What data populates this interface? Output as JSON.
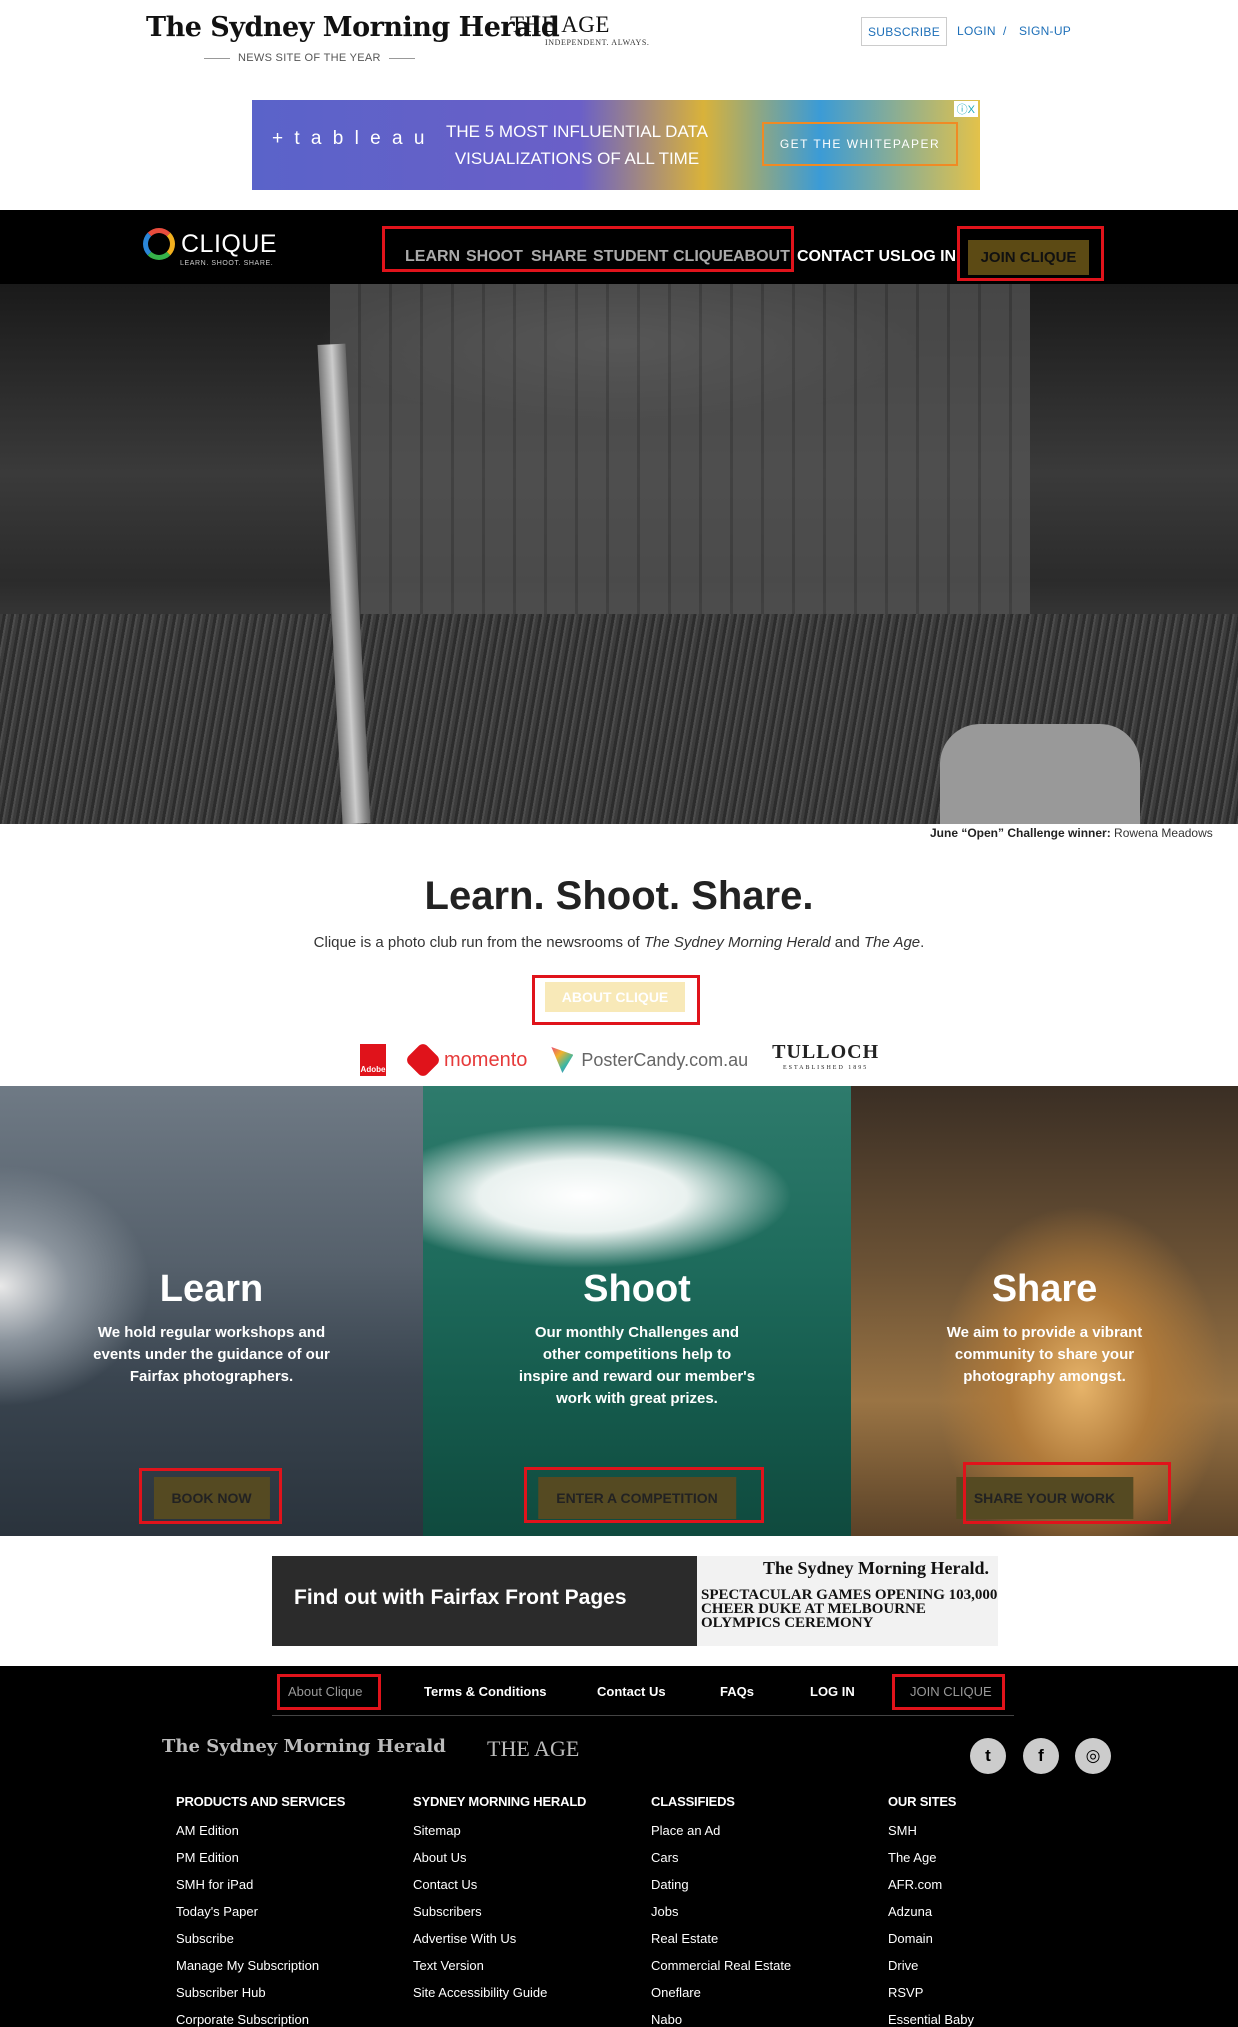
{
  "header": {
    "smh_logo": "The Sydney Morning Herald",
    "smh_tagline": "NEWS SITE OF THE YEAR",
    "age_logo": "THE AGE",
    "age_tagline": "INDEPENDENT. ALWAYS.",
    "subscribe": "SUBSCRIBE",
    "login": "LOGIN",
    "separator": "/",
    "signup": "SIGN-UP"
  },
  "top_ad": {
    "brand": "+ t a b l e a u",
    "headline": "THE 5 MOST INFLUENTIAL DATA VISUALIZATIONS OF ALL TIME",
    "cta": "GET THE WHITEPAPER",
    "ad_choice": "ⓘX"
  },
  "nav": {
    "logo": "CLIQUE",
    "logo_tagline": "LEARN. SHOOT. SHARE.",
    "items": [
      "LEARN",
      "SHOOT",
      "SHARE",
      "STUDENT CLIQUE",
      "ABOUT"
    ],
    "contact": "CONTACT US",
    "login": "LOG IN",
    "join": "JOIN CLIQUE"
  },
  "hero": {
    "caption_label": "June “Open” Challenge winner:",
    "caption_name": "Rowena Meadows"
  },
  "intro": {
    "title": "Learn. Shoot. Share.",
    "text_before": "Clique is a photo club run from the newsrooms of ",
    "paper1": "The Sydney Morning Herald",
    "text_and": " and ",
    "paper2": "The Age",
    "text_after": ".",
    "button": "ABOUT CLIQUE"
  },
  "sponsors": {
    "adobe": "Adobe",
    "momento": "momento",
    "postercandy": "PosterCandy.com.au",
    "tulloch": "TULLOCH",
    "tulloch_sub": "ESTABLISHED 1895"
  },
  "panels": [
    {
      "title": "Learn",
      "text": "We hold regular workshops and events under the guidance of our Fairfax photographers.",
      "button": "BOOK NOW"
    },
    {
      "title": "Shoot",
      "text": "Our monthly Challenges and other competitions help to inspire and reward our member's work with great prizes.",
      "button": "ENTER A COMPETITION"
    },
    {
      "title": "Share",
      "text": "We aim to provide a vibrant community to share your photography amongst.",
      "button": "SHARE YOUR WORK"
    }
  ],
  "fairfax_ad": {
    "text": "Find out with Fairfax Front Pages",
    "paper_title": "The Sydney Morning Herald.",
    "paper_headline": "SPECTACULAR GAMES OPENING 103,000 CHEER DUKE AT MELBOURNE OLYMPICS CEREMONY"
  },
  "footer": {
    "nav": [
      "About Clique",
      "Terms & Conditions",
      "Contact Us",
      "FAQs",
      "LOG IN",
      "JOIN CLIQUE"
    ],
    "smh_logo": "The Sydney Morning Herald",
    "age_logo": "THE AGE",
    "social": [
      "t",
      "f",
      "◎"
    ],
    "columns": [
      {
        "heading": "PRODUCTS AND SERVICES",
        "links": [
          "AM Edition",
          "PM Edition",
          "SMH for iPad",
          "Today's Paper",
          "Subscribe",
          "Manage My Subscription",
          "Subscriber Hub",
          "Corporate Subscription"
        ]
      },
      {
        "heading": "SYDNEY MORNING HERALD",
        "links": [
          "Sitemap",
          "About Us",
          "Contact Us",
          "Subscribers",
          "Advertise With Us",
          "Text Version",
          "Site Accessibility Guide"
        ]
      },
      {
        "heading": "CLASSIFIEDS",
        "links": [
          "Place an Ad",
          "Cars",
          "Dating",
          "Jobs",
          "Real Estate",
          "Commercial Real Estate",
          "Oneflare",
          "Nabo"
        ]
      },
      {
        "heading": "OUR SITES",
        "links": [
          "SMH",
          "The Age",
          "AFR.com",
          "Adzuna",
          "Domain",
          "Drive",
          "RSVP",
          "Essential Baby"
        ]
      }
    ]
  },
  "colors": {
    "nav_bg": "#000000",
    "join_button": "#5c4a14",
    "about_button": "#f8e9b8",
    "highlight_box": "#e0131b",
    "link_blue": "#1d6fb8"
  }
}
